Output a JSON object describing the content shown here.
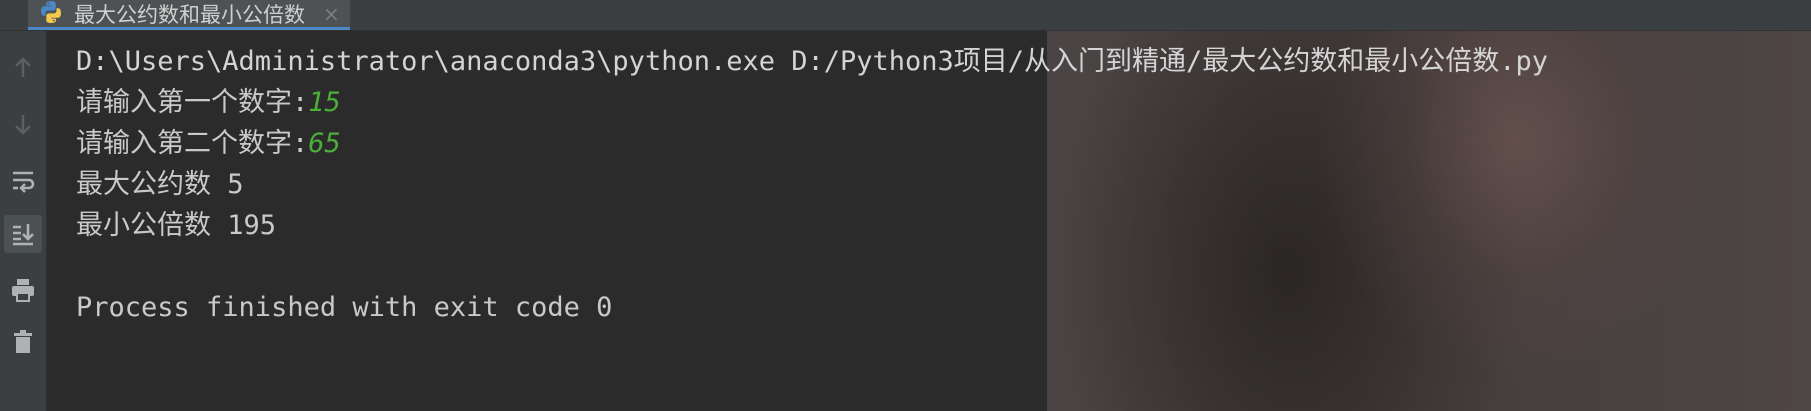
{
  "tab": {
    "title": "最大公约数和最小公倍数",
    "close_symbol": "×",
    "icon": "python-icon"
  },
  "toolbar": {
    "buttons": [
      {
        "name": "up-arrow-icon",
        "label": "Up"
      },
      {
        "name": "down-arrow-icon",
        "label": "Down"
      },
      {
        "name": "soft-wrap-icon",
        "label": "Soft-wrap"
      },
      {
        "name": "scroll-to-end-icon",
        "label": "Scroll to end"
      },
      {
        "name": "print-icon",
        "label": "Print"
      },
      {
        "name": "trash-icon",
        "label": "Clear all"
      }
    ]
  },
  "console": {
    "command": "D:\\Users\\Administrator\\anaconda3\\python.exe D:/Python3项目/从入门到精通/最大公约数和最小公倍数.py",
    "prompt1": "请输入第一个数字:",
    "input1": "15",
    "prompt2": "请输入第二个数字:",
    "input2": "65",
    "gcd_line": "最大公约数 5",
    "lcm_line": "最小公倍数 195",
    "exit_line": "Process finished with exit code 0"
  },
  "colors": {
    "background": "#2b2b2b",
    "toolbar": "#3c3f41",
    "text": "#c9c9c9",
    "user_input": "#4caf3a",
    "tab_accent": "#4a88c7"
  }
}
